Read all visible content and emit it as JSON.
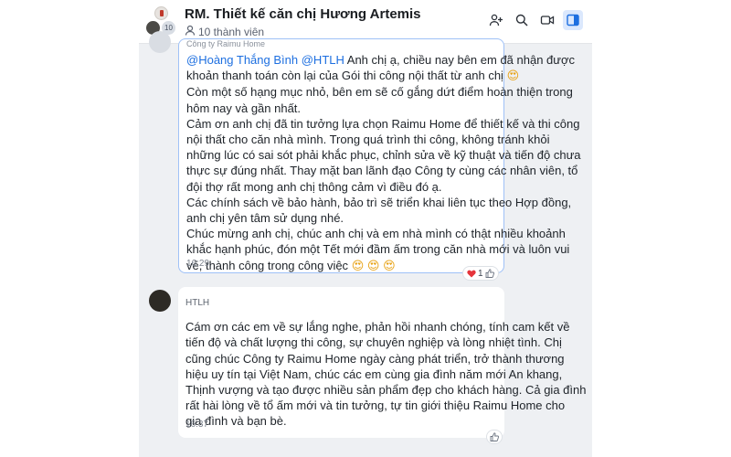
{
  "header": {
    "title": "RM. Thiết kế căn chị Hương Artemis",
    "avatar_count": "10",
    "members": "10 thành viên",
    "icons": [
      "add-member-icon",
      "search-icon",
      "video-call-icon",
      "sidebar-toggle-icon"
    ]
  },
  "message1": {
    "reply_hint": "Công ty Raimu Home",
    "mention1": "@Hoàng Thắng Bình",
    "mention2": "@HTLH",
    "line1_rest": " Anh chị ạ, chiều nay bên em đã nhận được",
    "line2": "khoản thanh toán còn lại của Gói thi công nội thất từ anh chị",
    "line3": "Còn một số hạng mục nhỏ, bên em sẽ cố gắng dứt điểm hoàn thiện trong",
    "line4": "hôm nay và gần nhất.",
    "line5": "Cảm ơn anh chị đã tin tưởng lựa chọn Raimu Home để thiết kế và thi công",
    "line6": "nội thất cho căn nhà mình. Trong quá trình thi công, không tránh khỏi",
    "line7": "những lúc có sai sót phải khắc phục, chỉnh sửa về kỹ thuật và tiến độ chưa",
    "line8": "thực sự đúng nhất. Thay mặt ban lãnh đạo Công ty cùng các nhân viên, tổ",
    "line9": "đội thợ rất mong anh chị thông cảm vì điều đó ạ.",
    "line10": "Các chính sách về bảo hành, bảo trì sẽ triển khai liên tục theo Hợp đồng,",
    "line11": "anh chị yên tâm sử dụng nhé.",
    "line12": "Chúc mừng anh chị, chúc anh chị và em nhà mình có thật nhiều khoảnh",
    "line13": "khắc hạnh phúc, đón một Tết mới đầm ấm trong căn nhà mới và luôn vui",
    "line14": "vẻ, thành công trong công việc",
    "emoji": "😍",
    "time": "16:29",
    "reaction_count": "1"
  },
  "message2": {
    "sender": "HTLH",
    "line1": "Cám ơn các em về sự lắng nghe, phản hồi nhanh chóng, tính cam kết về",
    "line2": "tiến độ và chất lượng thi công, sự chuyên nghiệp và lòng nhiệt tình. Chị",
    "line3": "cũng chúc Công ty Raimu Home ngày càng phát triển, trở thành thương",
    "line4": "hiệu uy tín tại Việt Nam, chúc các em cùng gia đình năm mới An khang,",
    "line5": "Thịnh vượng và tạo được nhiều sản phẩm đẹp cho khách hàng. Cả gia đình",
    "line6": "rất hài lòng về tổ ấm mới và tin tưởng, tự tin  giới thiệu Raimu Home cho",
    "line7": "gia đình và bạn bè.",
    "time": "16:37"
  },
  "colors": {
    "accent": "#1d6fe0",
    "highlight_border": "#9fc1f7",
    "panel_bg": "#eef0f3",
    "heart": "#e5343b"
  }
}
